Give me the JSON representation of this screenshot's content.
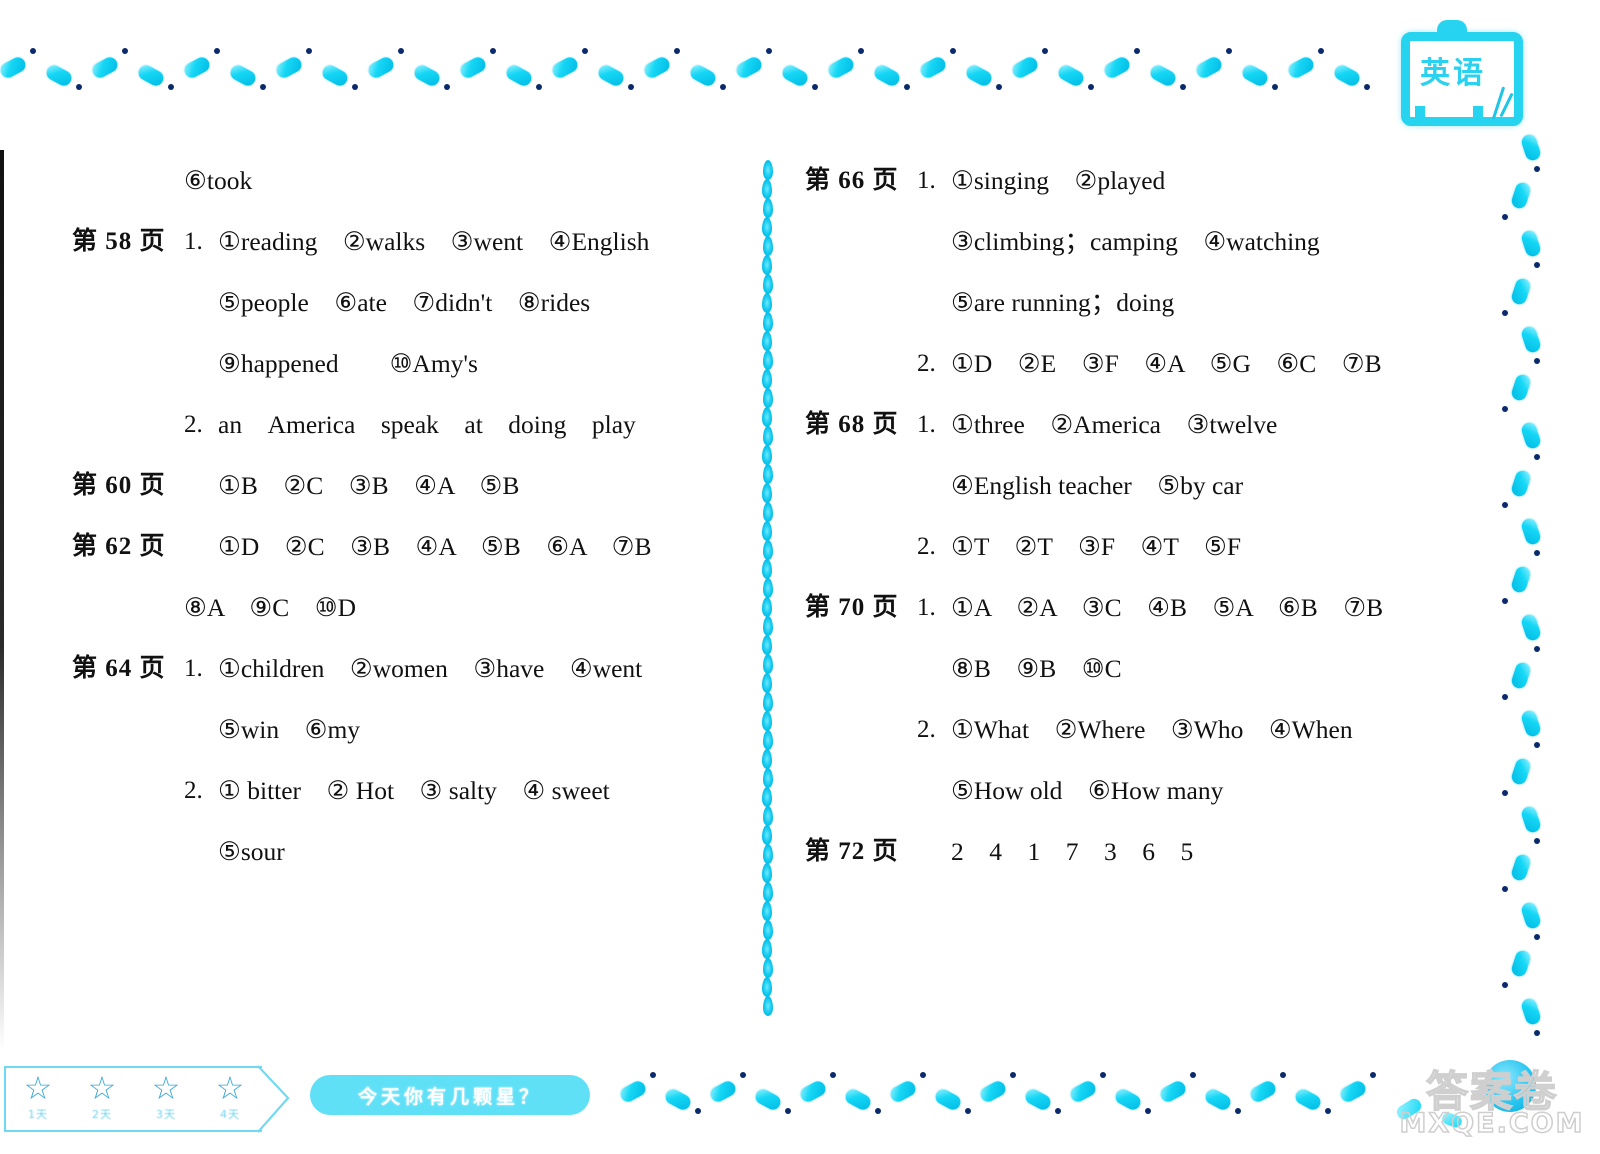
{
  "badge": {
    "subject_label": "英语",
    "color": "#27d4f0"
  },
  "decor": {
    "capsule_color": "#16d7f5",
    "dot_color": "#0b2a6b",
    "divider_color": "#19cdf0"
  },
  "left_column": [
    {
      "page_label": "",
      "question_no": "",
      "indent": "indent-1",
      "answers": "⑥took"
    },
    {
      "page_label": "第 58 页",
      "question_no": "1.",
      "indent": "",
      "answers": "①reading　②walks　③went　④English"
    },
    {
      "page_label": "",
      "question_no": "",
      "indent": "indent-2",
      "answers": "⑤people　⑥ate　⑦didn't　⑧rides"
    },
    {
      "page_label": "",
      "question_no": "",
      "indent": "indent-2",
      "answers": "⑨happened　　⑩Amy's"
    },
    {
      "page_label": "",
      "question_no": "2.",
      "indent": "indent-1",
      "answers": "an　America　speak　at　doing　play"
    },
    {
      "page_label": "第 60 页",
      "question_no": "",
      "indent": "",
      "answers": "①B　②C　③B　④A　⑤B"
    },
    {
      "page_label": "第 62 页",
      "question_no": "",
      "indent": "",
      "answers": "①D　②C　③B　④A　⑤B　⑥A　⑦B"
    },
    {
      "page_label": "",
      "question_no": "",
      "indent": "indent-1",
      "answers": "⑧A　⑨C　⑩D"
    },
    {
      "page_label": "第 64 页",
      "question_no": "1.",
      "indent": "",
      "answers": "①children　②women　③have　④went"
    },
    {
      "page_label": "",
      "question_no": "",
      "indent": "indent-2",
      "answers": "⑤win　⑥my"
    },
    {
      "page_label": "",
      "question_no": "2.",
      "indent": "indent-1",
      "answers": "① bitter　② Hot　③ salty　④ sweet"
    },
    {
      "page_label": "",
      "question_no": "",
      "indent": "indent-2",
      "answers": "⑤sour"
    }
  ],
  "right_column": [
    {
      "page_label": "第 66 页",
      "question_no": "1.",
      "indent": "",
      "answers": "①singing　②played"
    },
    {
      "page_label": "",
      "question_no": "",
      "indent": "indent-2",
      "answers": "③climbing；camping　④watching"
    },
    {
      "page_label": "",
      "question_no": "",
      "indent": "indent-2",
      "answers": "⑤are running；doing"
    },
    {
      "page_label": "",
      "question_no": "2.",
      "indent": "indent-1",
      "answers": "①D　②E　③F　④A　⑤G　⑥C　⑦B"
    },
    {
      "page_label": "第 68 页",
      "question_no": "1.",
      "indent": "",
      "answers": "①three　②America　③twelve"
    },
    {
      "page_label": "",
      "question_no": "",
      "indent": "indent-2",
      "answers": "④English teacher　⑤by car"
    },
    {
      "page_label": "",
      "question_no": "2.",
      "indent": "indent-1",
      "answers": "①T　②T　③F　④T　⑤F"
    },
    {
      "page_label": "第 70 页",
      "question_no": "1.",
      "indent": "",
      "answers": "①A　②A　③C　④B　⑤A　⑥B　⑦B"
    },
    {
      "page_label": "",
      "question_no": "",
      "indent": "indent-2",
      "answers": "⑧B　⑨B　⑩C"
    },
    {
      "page_label": "",
      "question_no": "2.",
      "indent": "indent-1",
      "answers": "①What　②Where　③Who　④When"
    },
    {
      "page_label": "",
      "question_no": "",
      "indent": "indent-2",
      "answers": "⑤How old　⑥How many"
    },
    {
      "page_label": "第 72 页",
      "question_no": "",
      "indent": "",
      "answers": "2　4　1　7　3　6　5"
    }
  ],
  "footer": {
    "stars": [
      {
        "glyph": "☆",
        "label": "1天"
      },
      {
        "glyph": "☆",
        "label": "2天"
      },
      {
        "glyph": "☆",
        "label": "3天"
      },
      {
        "glyph": "☆",
        "label": "4天"
      }
    ],
    "prompt": "今天你有几颗星？"
  },
  "watermark": {
    "chinese": "答案卷",
    "english": "MXQE.COM"
  }
}
